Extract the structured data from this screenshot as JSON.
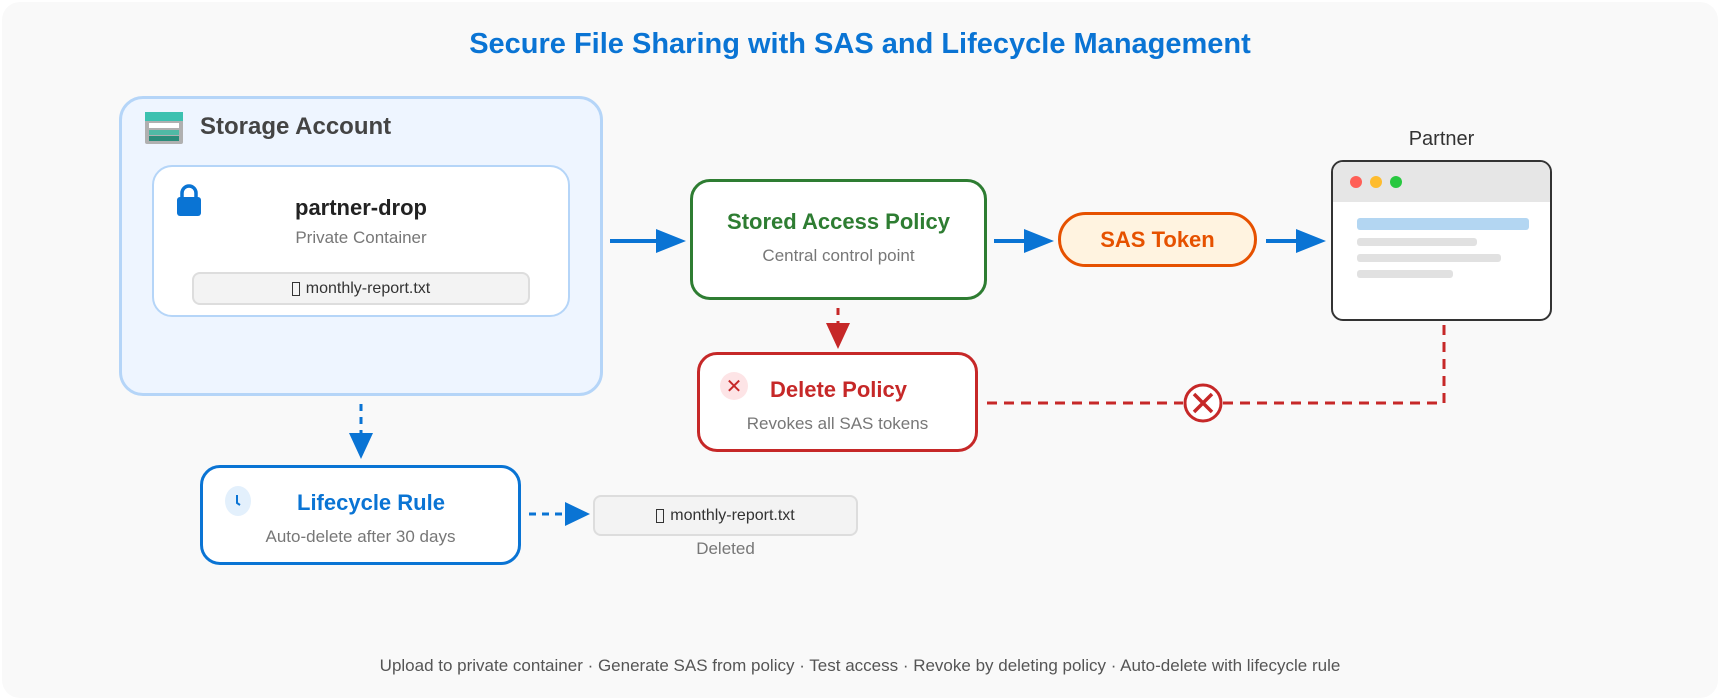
{
  "title": "Secure File Sharing with SAS and Lifecycle Management",
  "storage": {
    "title": "Storage Account",
    "container_name": "partner-drop",
    "container_type": "Private Container",
    "file": "monthly-report.txt"
  },
  "policy": {
    "title": "Stored Access Policy",
    "subtitle": "Central control point"
  },
  "sas": {
    "label": "SAS Token"
  },
  "partner": {
    "label": "Partner"
  },
  "delete_policy": {
    "title": "Delete Policy",
    "subtitle": "Revokes all SAS tokens"
  },
  "lifecycle": {
    "title": "Lifecycle Rule",
    "subtitle": "Auto-delete after 30 days"
  },
  "deleted_file": {
    "file": "monthly-report.txt",
    "status": "Deleted"
  },
  "footer": "Upload to private container · Generate SAS from policy · Test access · Revoke by deleting policy · Auto-delete with lifecycle rule",
  "colors": {
    "blue": "#0a74d4",
    "green": "#2e7d32",
    "orange": "#e65100",
    "red": "#c62828"
  }
}
